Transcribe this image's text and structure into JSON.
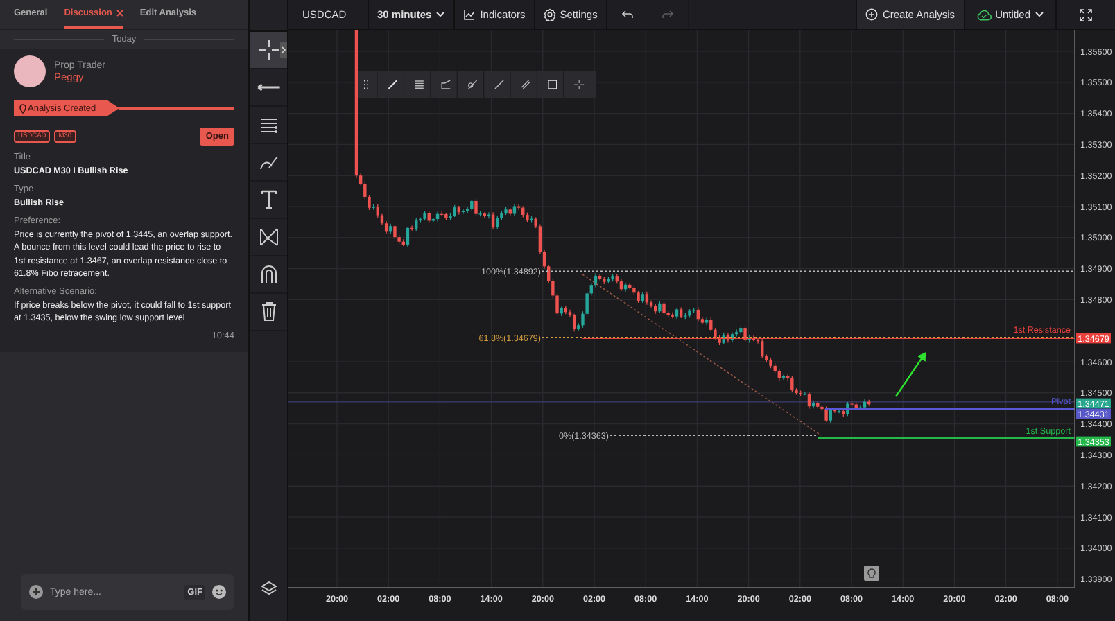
{
  "sidebar": {
    "tabs": [
      {
        "label": "General",
        "selected": false,
        "closable": false
      },
      {
        "label": "Discussion",
        "selected": true,
        "closable": true
      },
      {
        "label": "Edit Analysis",
        "selected": false,
        "closable": false
      }
    ],
    "date_divider": "Today",
    "message": {
      "role": "Prop Trader",
      "author": "Peggy",
      "event": "Analysis Created",
      "tags": [
        "USDCAD",
        "M30"
      ],
      "open_button": "Open",
      "fields": [
        {
          "kind": "heading",
          "label": "Title",
          "value": "USDCAD M30 I Bullish Rise"
        },
        {
          "kind": "heading",
          "label": "Type",
          "value": "Bullish Rise"
        },
        {
          "kind": "paragraph",
          "label": "Preference:",
          "value": "Price is currently the pivot of 1.3445, an overlap support. A bounce from this level could lead the price to rise to 1st resistance at 1.3467, an overlap resistance close to 61.8% Fibo retracement."
        },
        {
          "kind": "paragraph",
          "label": "Alternative Scenario:",
          "value": "If price breaks below the pivot, it could fall to 1st support at 1.3435, below the swing low support level"
        }
      ],
      "time": "10:44"
    },
    "composer": {
      "placeholder": "Type here...",
      "gif": "GIF"
    }
  },
  "drawing_tools": [
    {
      "selected": true
    },
    {
      "selected": false
    },
    {
      "selected": false
    },
    {
      "selected": false
    },
    {
      "selected": false
    },
    {
      "selected": false
    },
    {
      "selected": false
    },
    {
      "selected": false
    }
  ],
  "toolbar": {
    "symbol": "USDCAD",
    "interval": "30 minutes",
    "indicators": "Indicators",
    "settings": "Settings",
    "undo_enabled": true,
    "redo_enabled": false,
    "create": "Create Analysis",
    "layout_name": "Untitled",
    "saved": true
  },
  "chart": {
    "price_axis": [
      "1.35600",
      "1.35500",
      "1.35400",
      "1.35300",
      "1.35200",
      "1.35100",
      "1.35000",
      "1.34900",
      "1.34800",
      "1.34600",
      "1.34500",
      "1.34400",
      "1.34300",
      "1.34200",
      "1.34100",
      "1.34000",
      "1.33900"
    ],
    "time_axis": [
      "20:00",
      "02:00",
      "08:00",
      "14:00",
      "20:00",
      "02:00",
      "08:00",
      "14:00",
      "20:00",
      "02:00",
      "08:00",
      "14:00",
      "20:00",
      "02:00",
      "08:00"
    ],
    "fib_levels": [
      {
        "label": "100%(1.34892)"
      },
      {
        "label": "61.8%(1.34679)"
      },
      {
        "label": "0%(1.34363)"
      }
    ],
    "lines": [
      {
        "kind": "resistance",
        "label": "1st Resistance",
        "tags": [
          {
            "text": "1.34679",
            "color": "#e8413c"
          }
        ]
      },
      {
        "kind": "pivot",
        "label": "Pivot",
        "tags": [
          {
            "text": "1.34471",
            "color": "#2aa88f"
          },
          {
            "text": "1.34431",
            "color": "#5858c8"
          }
        ]
      },
      {
        "kind": "support",
        "label": "1st Support",
        "tags": [
          {
            "text": "1.34353",
            "color": "#25b84a"
          }
        ]
      }
    ]
  }
}
